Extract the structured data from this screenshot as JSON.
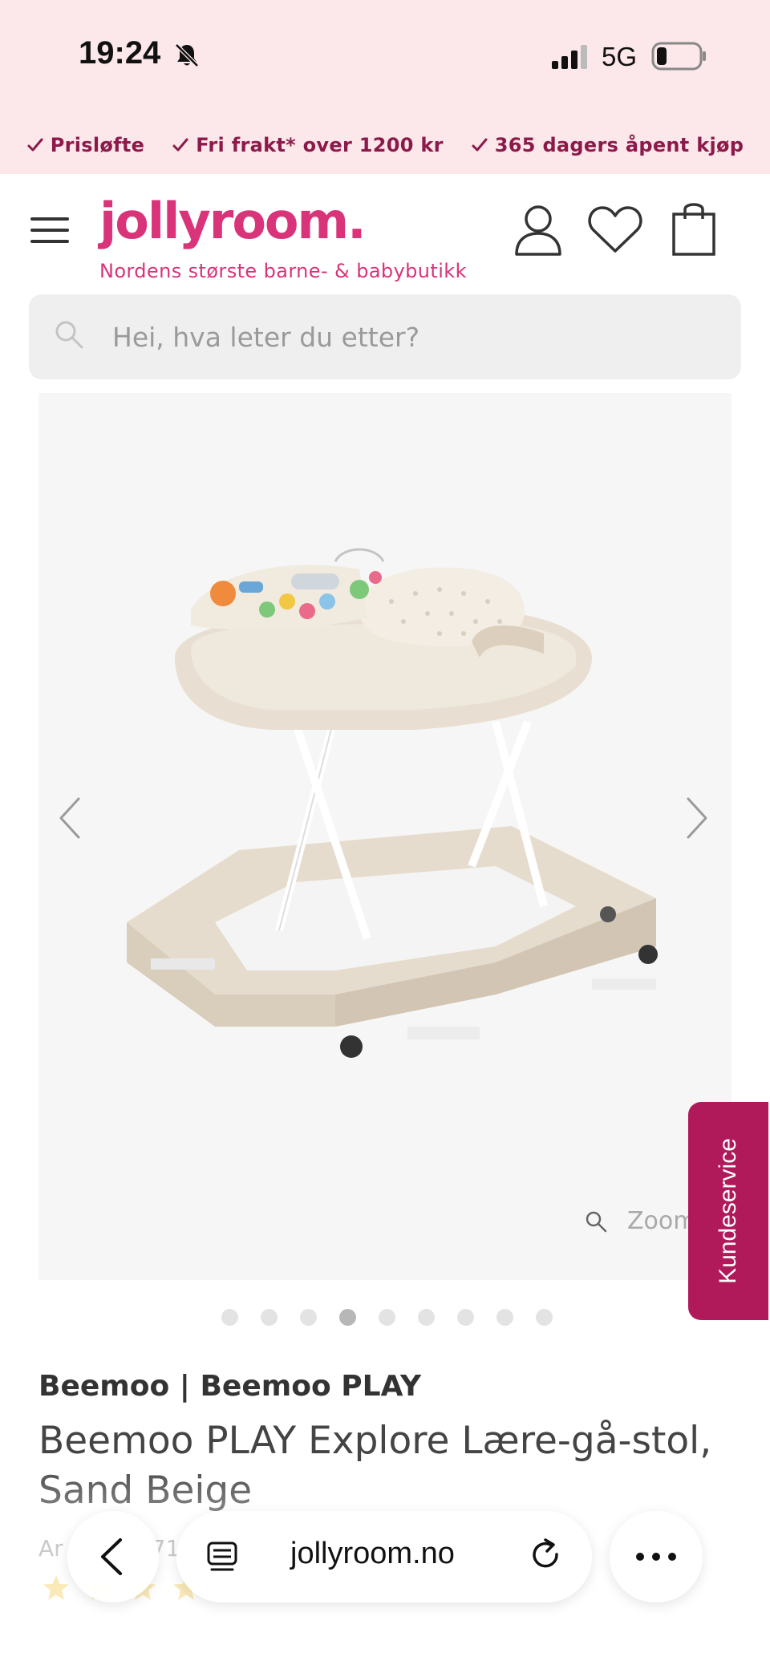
{
  "status_bar": {
    "time": "19:24",
    "network": "5G",
    "icons": [
      "bell-slash-icon",
      "signal-icon",
      "battery-icon"
    ]
  },
  "promo": {
    "items": [
      "Prisløfte",
      "Fri frakt* over 1200 kr",
      "365 dagers åpent kjøp"
    ],
    "color": "#8b1a4a",
    "background": "#fce7ea"
  },
  "header": {
    "logo": "jollyroom.",
    "tagline": "Nordens største barne- & babybutikk",
    "brand_color": "#d9337a",
    "icons": [
      "menu-icon",
      "user-icon",
      "heart-icon",
      "bag-icon"
    ]
  },
  "search": {
    "placeholder": "Hei, hva leter du etter?"
  },
  "gallery": {
    "zoom_label": "Zoom",
    "slide_count": 9,
    "active_slide": 4
  },
  "customer_service": {
    "label": "Kundeservice",
    "color": "#b01a5b"
  },
  "product": {
    "brand": "Beemoo | Beemoo PLAY",
    "title": "Beemoo PLAY Explore Lære-gå-stol, Sand Beige",
    "art_nr_visible": "Ar",
    "art_nr_tail": "71",
    "star_color": "#f2c744"
  },
  "browser": {
    "url": "jollyroom.no",
    "icons": [
      "back-icon",
      "tabs-icon",
      "reload-icon",
      "more-icon"
    ]
  }
}
